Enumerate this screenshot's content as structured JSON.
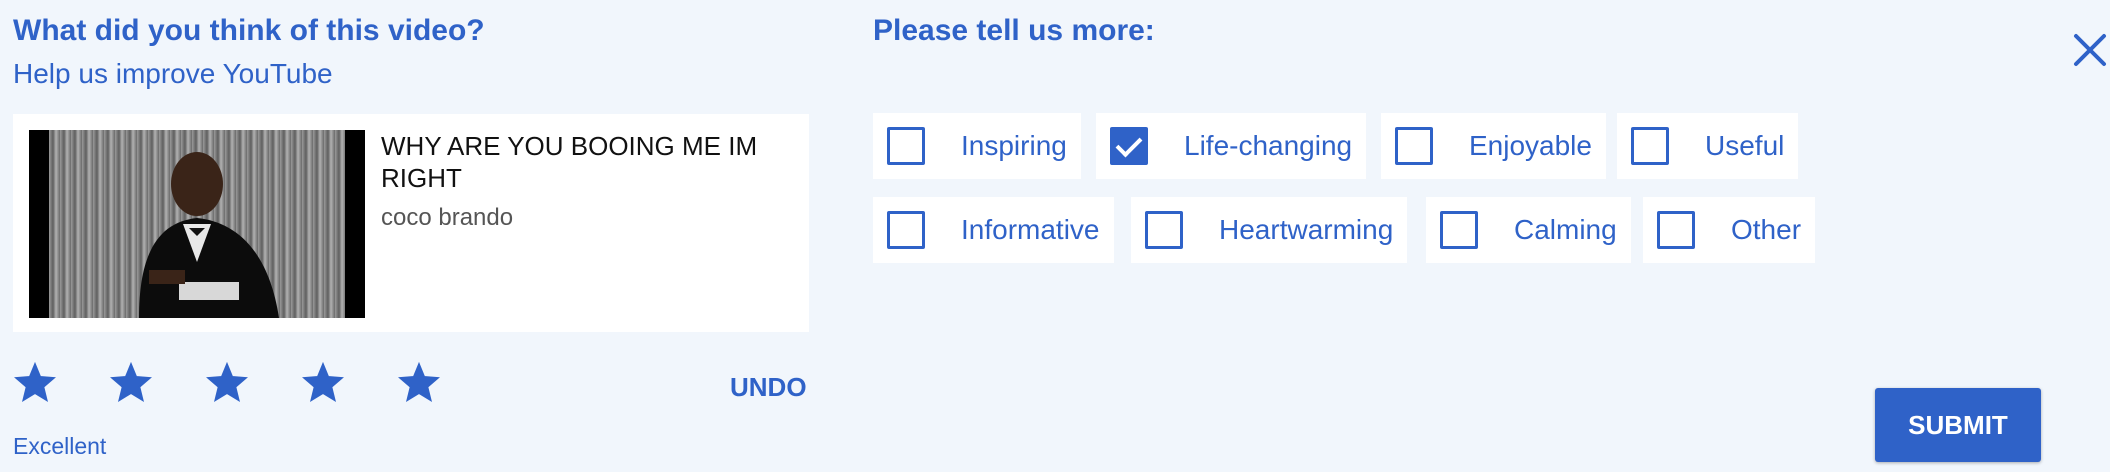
{
  "left": {
    "title": "What did you think of this video?",
    "subtitle": "Help us improve YouTube"
  },
  "video": {
    "title": "WHY ARE YOU BOOING ME IM RIGHT",
    "channel": "coco brando"
  },
  "rating": {
    "stars_total": 5,
    "stars_selected": 5,
    "label": "Excellent",
    "undo_label": "UNDO"
  },
  "right": {
    "title": "Please tell us more:"
  },
  "options": [
    {
      "label": "Inspiring",
      "checked": false
    },
    {
      "label": "Life-changing",
      "checked": true
    },
    {
      "label": "Enjoyable",
      "checked": false
    },
    {
      "label": "Useful",
      "checked": false
    },
    {
      "label": "Informative",
      "checked": false
    },
    {
      "label": "Heartwarming",
      "checked": false
    },
    {
      "label": "Calming",
      "checked": false
    },
    {
      "label": "Other",
      "checked": false
    }
  ],
  "submit_label": "SUBMIT",
  "colors": {
    "accent": "#2f62c8",
    "background": "#f1f6fc"
  },
  "icons": {
    "close": "close-icon",
    "star": "star-icon",
    "checkbox": "checkbox-icon"
  }
}
